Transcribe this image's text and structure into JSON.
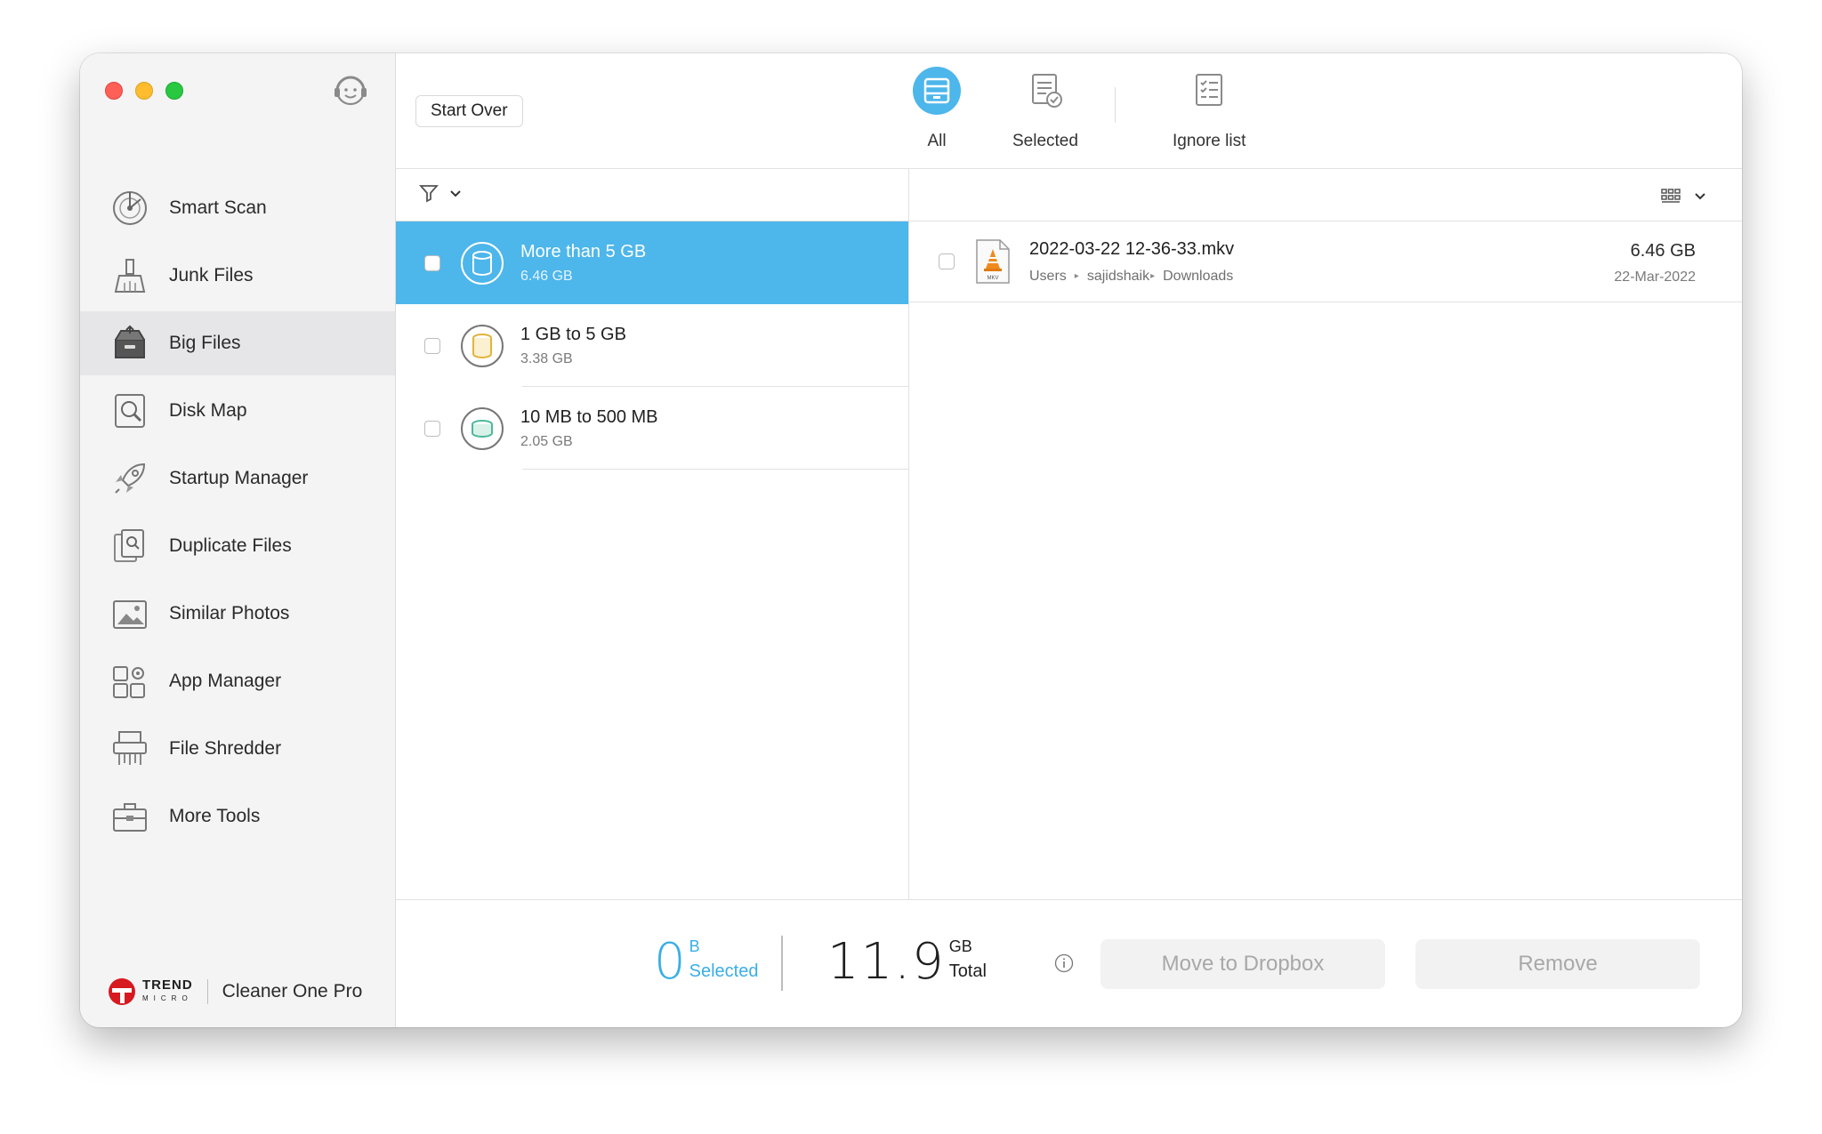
{
  "sidebar": {
    "items": [
      {
        "label": "Smart Scan",
        "icon": "radar-icon"
      },
      {
        "label": "Junk Files",
        "icon": "brush-icon"
      },
      {
        "label": "Big Files",
        "icon": "box-icon",
        "active": true
      },
      {
        "label": "Disk Map",
        "icon": "magnifier-icon"
      },
      {
        "label": "Startup Manager",
        "icon": "rocket-icon"
      },
      {
        "label": "Duplicate Files",
        "icon": "duplicate-icon"
      },
      {
        "label": "Similar Photos",
        "icon": "photo-icon"
      },
      {
        "label": "App Manager",
        "icon": "apps-icon"
      },
      {
        "label": "File Shredder",
        "icon": "shredder-icon"
      },
      {
        "label": "More Tools",
        "icon": "toolbox-icon"
      }
    ],
    "brand": {
      "company": "TREND",
      "company_sub": "MICRO",
      "product": "Cleaner One Pro"
    }
  },
  "toolbar": {
    "start_over": "Start Over",
    "tabs": [
      {
        "label": "All",
        "active": true
      },
      {
        "label": "Selected"
      },
      {
        "label": "Ignore list"
      }
    ]
  },
  "categories": [
    {
      "title": "More than 5 GB",
      "size": "6.46 GB",
      "active": true,
      "color": "#ffffff"
    },
    {
      "title": "1 GB to 5 GB",
      "size": "3.38 GB",
      "color": "#e3b33b"
    },
    {
      "title": "10 MB to 500 MB",
      "size": "2.05 GB",
      "color": "#4db89a"
    }
  ],
  "files": [
    {
      "name": "2022-03-22 12-36-33.mkv",
      "path": [
        "Users",
        "sajidshaik",
        "Downloads"
      ],
      "size": "6.46 GB",
      "date": "22-Mar-2022",
      "icon_label": "MKV"
    }
  ],
  "footer": {
    "selected_value": "0",
    "selected_unit": "B",
    "selected_label": "Selected",
    "total_value": "11.9",
    "total_unit": "GB",
    "total_label": "Total",
    "move_button": "Move to Dropbox",
    "remove_button": "Remove"
  },
  "colors": {
    "accent": "#4db6eb",
    "selected_text": "#3aaee6"
  }
}
